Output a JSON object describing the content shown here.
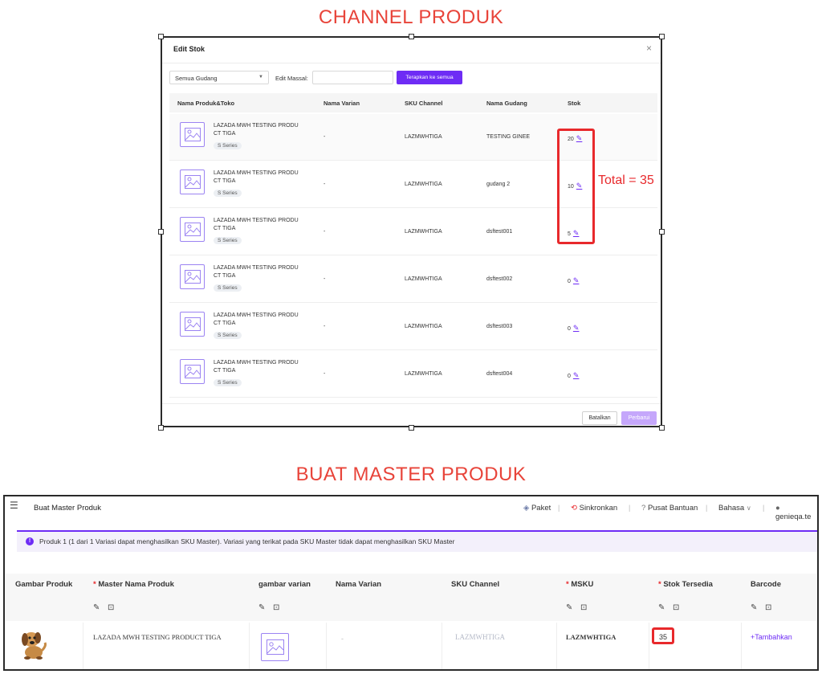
{
  "sections": {
    "channel_title": "CHANNEL PRODUK",
    "master_title": "BUAT MASTER PRODUK"
  },
  "edit_stok": {
    "title": "Edit Stok",
    "close": "×",
    "warehouse_select": "Semua Gudang",
    "bulk_edit_label": "Edit Massal:",
    "apply_all_button": "Terapkan ke semua",
    "columns": [
      "Nama Produk&Toko",
      "Nama Varian",
      "SKU Channel",
      "Nama Gudang",
      "Stok"
    ],
    "rows": [
      {
        "name_line1": "LAZADA MWH TESTING PRODU",
        "name_line2": "CT TIGA",
        "tag": "S Series",
        "variant": "-",
        "sku": "LAZMWHTIGA",
        "warehouse": "TESTING GINEE",
        "stock": "20"
      },
      {
        "name_line1": "LAZADA MWH TESTING PRODU",
        "name_line2": "CT TIGA",
        "tag": "S Series",
        "variant": "-",
        "sku": "LAZMWHTIGA",
        "warehouse": "gudang 2",
        "stock": "10"
      },
      {
        "name_line1": "LAZADA MWH TESTING PRODU",
        "name_line2": "CT TIGA",
        "tag": "S Series",
        "variant": "-",
        "sku": "LAZMWHTIGA",
        "warehouse": "dsftest001",
        "stock": "5"
      },
      {
        "name_line1": "LAZADA MWH TESTING PRODU",
        "name_line2": "CT TIGA",
        "tag": "S Series",
        "variant": "-",
        "sku": "LAZMWHTIGA",
        "warehouse": "dsftest002",
        "stock": "0"
      },
      {
        "name_line1": "LAZADA MWH TESTING PRODU",
        "name_line2": "CT TIGA",
        "tag": "S Series",
        "variant": "-",
        "sku": "LAZMWHTIGA",
        "warehouse": "dsftest003",
        "stock": "0"
      },
      {
        "name_line1": "LAZADA MWH TESTING PRODU",
        "name_line2": "CT TIGA",
        "tag": "S Series",
        "variant": "-",
        "sku": "LAZMWHTIGA",
        "warehouse": "dsftest004",
        "stock": "0"
      }
    ],
    "cancel_button": "Batalkan",
    "update_button": "Perbarui",
    "annotation_total": "Total = 35"
  },
  "master": {
    "menu_icon": "hamburger-menu-icon",
    "page_title": "Buat Master Produk",
    "topbar": {
      "paket": "Paket",
      "sinkronkan": "Sinkronkan",
      "pusat_bantuan": "Pusat Bantuan",
      "bahasa": "Bahasa",
      "user": "genieqa.te"
    },
    "banner": "Produk 1 (1 dari 1 Variasi dapat menghasilkan SKU Master). Variasi yang terikat pada SKU Master tidak dapat menghasilkan SKU Master",
    "columns": {
      "image": "Gambar Produk",
      "name": "Master Nama Produk",
      "variant_image": "gambar varian",
      "variant_name": "Nama Varian",
      "sku_channel": "SKU Channel",
      "msku": "MSKU",
      "stock": "Stok Tersedia",
      "barcode": "Barcode"
    },
    "row": {
      "product_name": "LAZADA MWH TESTING PRODUCT TIGA",
      "variant_name": "-",
      "sku_channel": "LAZMWHTIGA",
      "msku": "LAZMWHTIGA",
      "stock": "35",
      "barcode_action": "+Tambahkan"
    }
  },
  "colors": {
    "accent": "#6e2cf5",
    "annotation_red": "#e8292c",
    "title_red": "#e8443a"
  }
}
